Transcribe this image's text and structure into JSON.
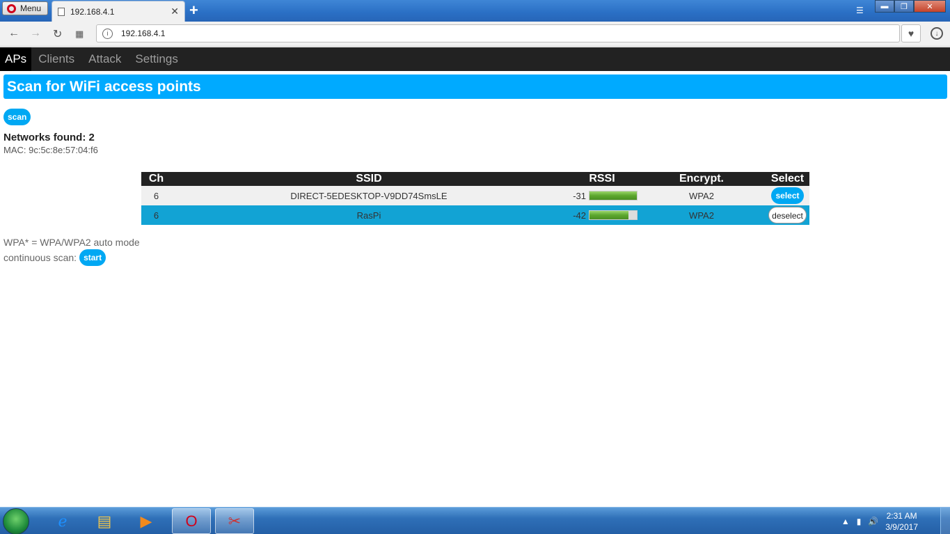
{
  "browser": {
    "menu_label": "Menu",
    "tab_title": "192.168.4.1",
    "tab_close": "✕",
    "new_tab": "+",
    "address": "192.168.4.1",
    "window_controls": [
      "▬",
      "❐",
      "✕"
    ]
  },
  "nav": {
    "items": [
      {
        "label": "APs",
        "active": true
      },
      {
        "label": "Clients",
        "active": false
      },
      {
        "label": "Attack",
        "active": false
      },
      {
        "label": "Settings",
        "active": false
      }
    ]
  },
  "header": {
    "title": "Scan for WiFi access points"
  },
  "scan": {
    "button_label": "scan"
  },
  "results": {
    "networks_found": "Networks found: 2",
    "mac": "MAC: 9c:5c:8e:57:04:f6"
  },
  "table": {
    "headers": [
      "Ch",
      "SSID",
      "RSSI",
      "Encrypt.",
      "Select"
    ],
    "rows": [
      {
        "ch": "6",
        "ssid": "DIRECT-5EDESKTOP-V9DD74SmsLE",
        "rssi": "-31",
        "rssi_level": 1.0,
        "enc": "WPA2",
        "action": "select",
        "selected": false
      },
      {
        "ch": "6",
        "ssid": "RasPi",
        "rssi": "-42",
        "rssi_level": 0.83,
        "enc": "WPA2",
        "action": "deselect",
        "selected": true
      }
    ]
  },
  "footer": {
    "note": "WPA* = WPA/WPA2 auto mode",
    "continuous_label": "continuous scan:",
    "start_label": "start"
  },
  "taskbar": {
    "time": "2:31 AM",
    "date": "3/9/2017"
  },
  "colors": {
    "accent": "#00aaff",
    "nav_bg": "#222222",
    "selected_row": "#12a3d4"
  }
}
